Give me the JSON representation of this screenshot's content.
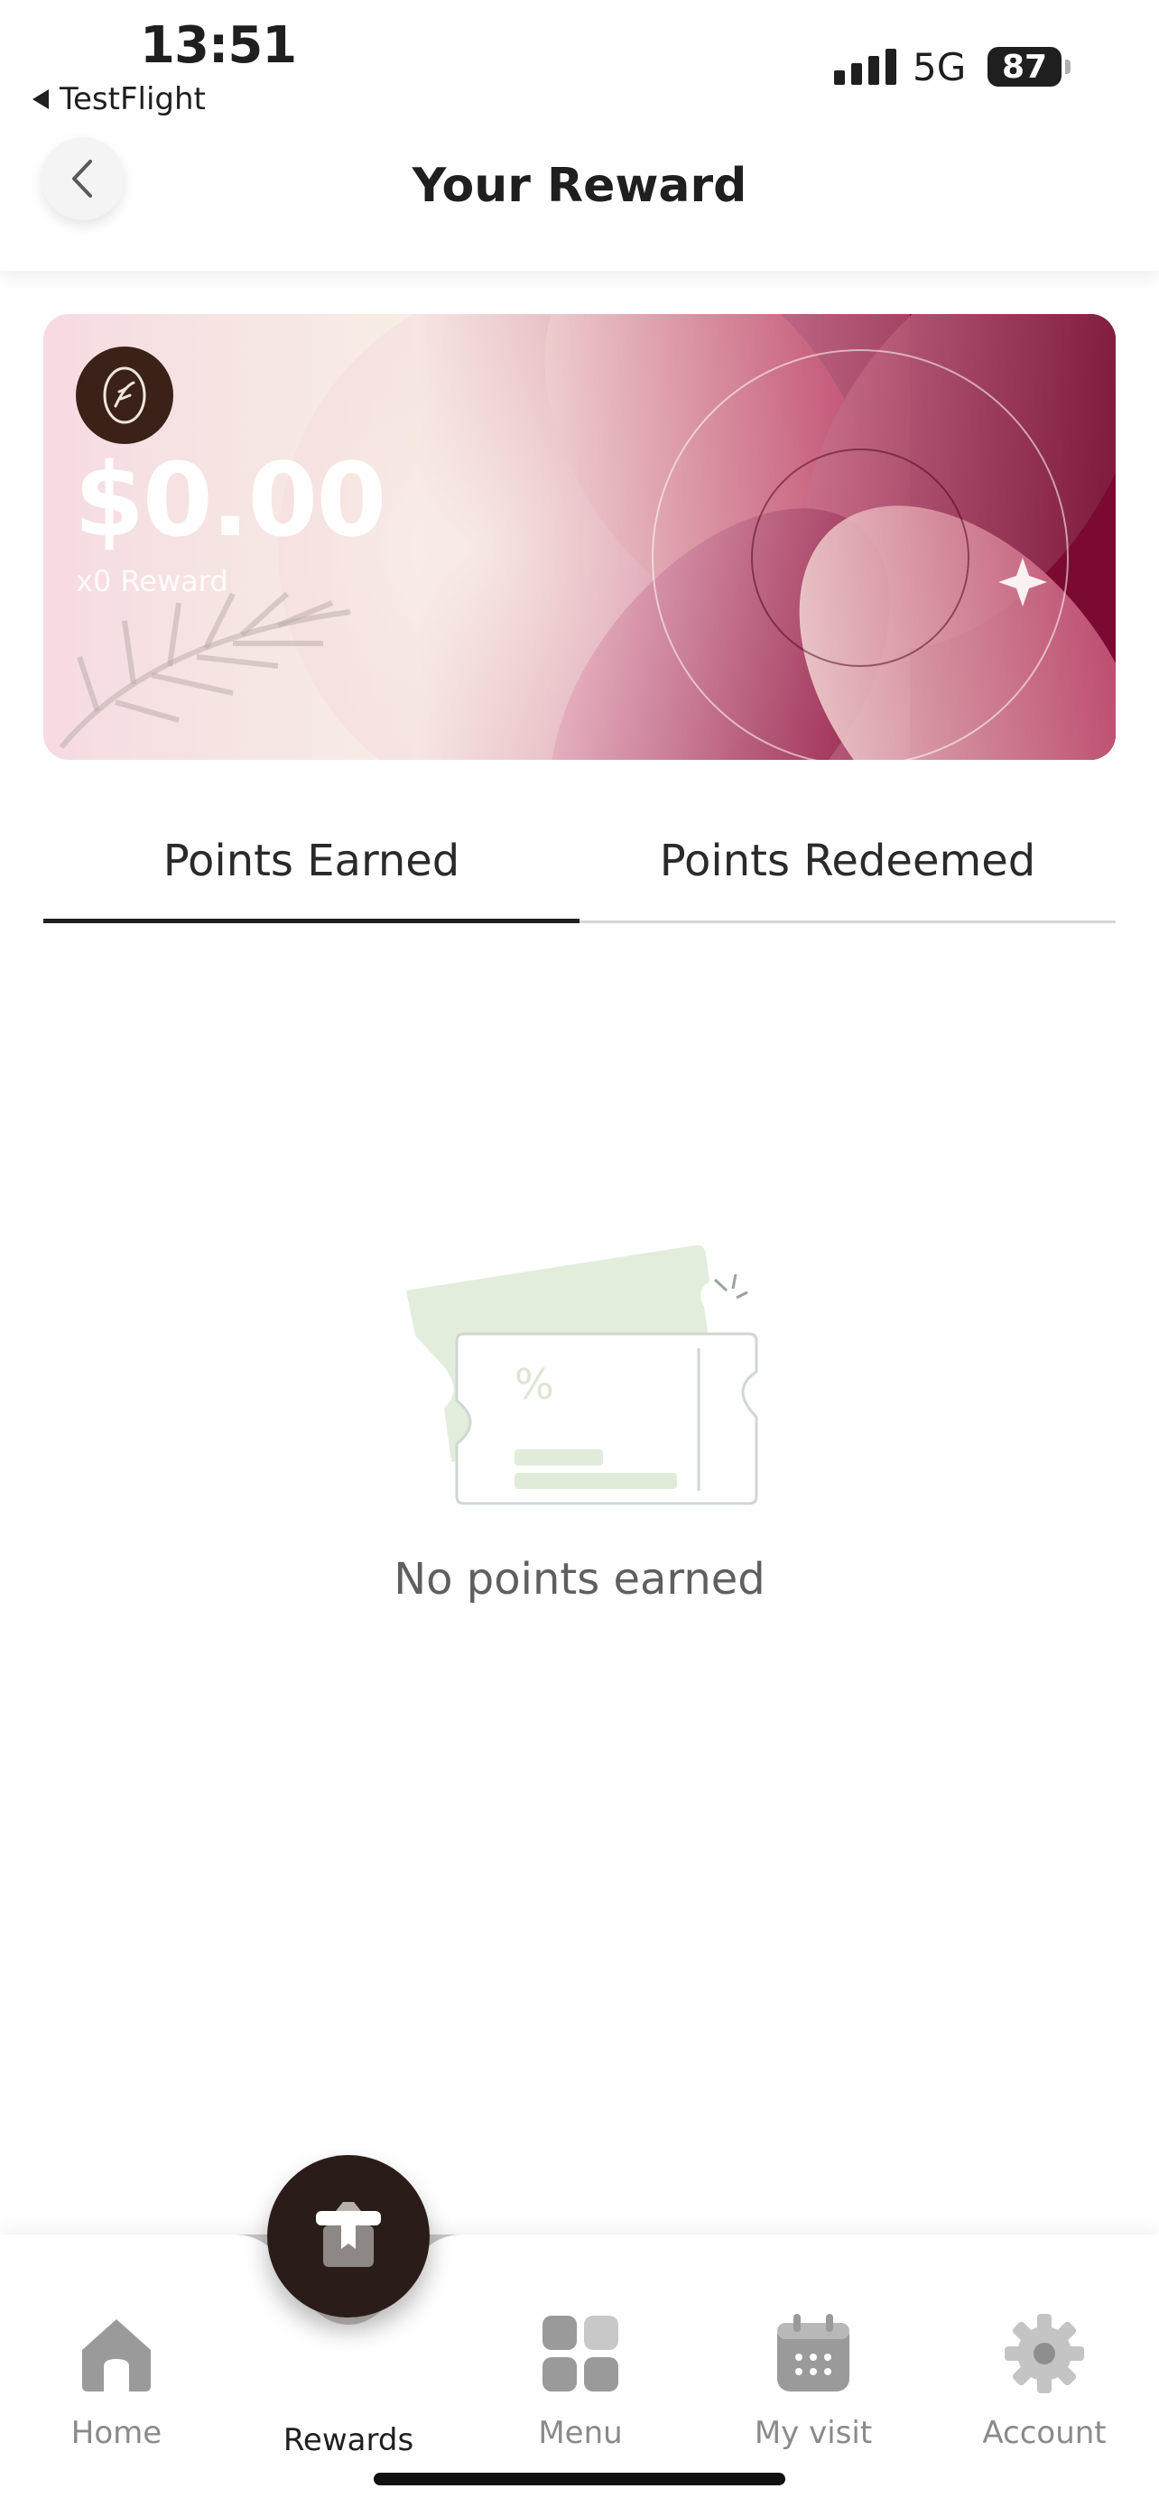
{
  "status_bar": {
    "time": "13:51",
    "back_app": "TestFlight",
    "network": "5G",
    "battery": "87"
  },
  "header": {
    "title": "Your Reward",
    "back_icon": "chevron-left-icon"
  },
  "reward_card": {
    "amount": "$0.00",
    "reward_count": "x0 Reward",
    "colors": [
      "#f6dfe4",
      "#f7eee4",
      "#c96a88",
      "#8a0f3a"
    ]
  },
  "tabs": {
    "earned": "Points Earned",
    "redeemed": "Points Redeemed",
    "active": "earned"
  },
  "empty_state": {
    "icon": "ticket-icon",
    "message": "No points earned"
  },
  "bottom_nav": {
    "items": [
      {
        "label": "Home",
        "icon": "home-icon"
      },
      {
        "label": "Rewards",
        "icon": "gift-icon",
        "active": true
      },
      {
        "label": "Menu",
        "icon": "grid-icon"
      },
      {
        "label": "My visit",
        "icon": "calendar-icon"
      },
      {
        "label": "Account",
        "icon": "gear-icon"
      }
    ]
  },
  "colors": {
    "accent_dark": "#2a1d19",
    "inactive": "#8a8a8a"
  }
}
